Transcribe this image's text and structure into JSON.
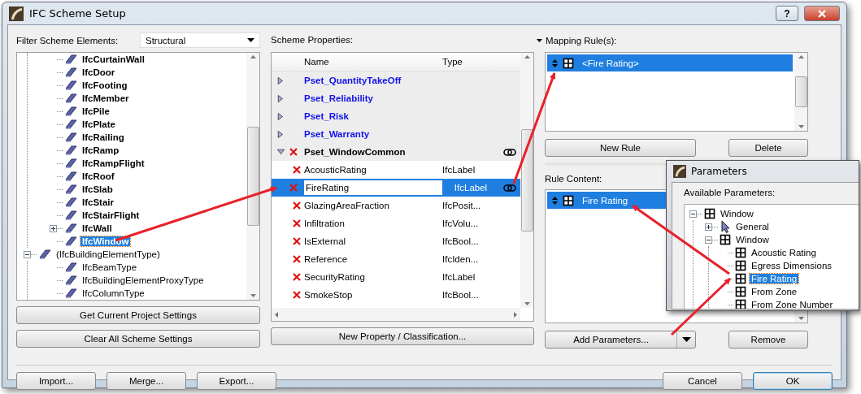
{
  "window": {
    "title": "IFC Scheme Setup",
    "help_button": "?"
  },
  "filter": {
    "label": "Filter Scheme Elements:",
    "value": "Structural"
  },
  "element_tree": [
    {
      "children": [
        {
          "label": "IfcCurtainWall",
          "selected": false
        },
        {
          "label": "IfcDoor",
          "selected": false
        },
        {
          "label": "IfcFooting",
          "selected": false
        },
        {
          "label": "IfcMember",
          "selected": false
        },
        {
          "label": "IfcPile",
          "selected": false
        },
        {
          "label": "IfcPlate",
          "selected": false
        },
        {
          "label": "IfcRailing",
          "selected": false
        },
        {
          "label": "IfcRamp",
          "selected": false
        },
        {
          "label": "IfcRampFlight",
          "selected": false
        },
        {
          "label": "IfcRoof",
          "selected": false
        },
        {
          "label": "IfcSlab",
          "selected": false
        },
        {
          "label": "IfcStair",
          "selected": false
        },
        {
          "label": "IfcStairFlight",
          "selected": false
        },
        {
          "label": "IfcWall",
          "selected": false,
          "expanded": false
        },
        {
          "label": "IfcWindow",
          "selected": true
        }
      ]
    },
    {
      "label": "(IfcBuildingElementType)",
      "selected": false,
      "expanded": true,
      "children": [
        {
          "label": "IfcBeamType",
          "selected": false
        },
        {
          "label": "IfcBuildingElementProxyType",
          "selected": false
        },
        {
          "label": "IfcColumnType",
          "selected": false
        }
      ]
    }
  ],
  "left_buttons": [
    "Get Current Project Settings",
    "Clear All Scheme Settings"
  ],
  "scheme_properties": {
    "label": "Scheme Properties:",
    "columns": [
      "Name",
      "Type"
    ],
    "rows": [
      {
        "kind": "pset",
        "name": "Pset_QuantityTakeOff",
        "expanded": false,
        "deletable": false,
        "linked": false,
        "selected": false
      },
      {
        "kind": "pset",
        "name": "Pset_Reliability",
        "expanded": false,
        "deletable": false,
        "linked": false,
        "selected": false
      },
      {
        "kind": "pset",
        "name": "Pset_Risk",
        "expanded": false,
        "deletable": false,
        "linked": false,
        "selected": false
      },
      {
        "kind": "pset",
        "name": "Pset_Warranty",
        "expanded": false,
        "deletable": false,
        "linked": false,
        "selected": false
      },
      {
        "kind": "pset",
        "name": "Pset_WindowCommon",
        "expanded": true,
        "deletable": true,
        "linked": true,
        "selected": false
      },
      {
        "kind": "property",
        "name": "AcousticRating",
        "type": "IfcLabel",
        "deletable": true,
        "linked": false,
        "selected": false
      },
      {
        "kind": "property",
        "name": "FireRating",
        "type": "IfcLabel",
        "deletable": true,
        "linked": true,
        "selected": true
      },
      {
        "kind": "property",
        "name": "GlazingAreaFraction",
        "type": "IfcPosit...",
        "deletable": true,
        "linked": false,
        "selected": false
      },
      {
        "kind": "property",
        "name": "Infiltration",
        "type": "IfcVolu...",
        "deletable": true,
        "linked": false,
        "selected": false
      },
      {
        "kind": "property",
        "name": "IsExternal",
        "type": "IfcBool...",
        "deletable": true,
        "linked": false,
        "selected": false
      },
      {
        "kind": "property",
        "name": "Reference",
        "type": "IfcIden...",
        "deletable": true,
        "linked": false,
        "selected": false
      },
      {
        "kind": "property",
        "name": "SecurityRating",
        "type": "IfcLabel",
        "deletable": true,
        "linked": false,
        "selected": false
      },
      {
        "kind": "property",
        "name": "SmokeStop",
        "type": "IfcBool...",
        "deletable": true,
        "linked": false,
        "selected": false
      }
    ],
    "button": "New Property / Classification..."
  },
  "mapping_rules": {
    "label": "Mapping Rule(s):",
    "rules": [
      {
        "text": "<Fire Rating>",
        "selected": true
      }
    ],
    "buttons": [
      "New Rule",
      "Delete"
    ]
  },
  "rule_content": {
    "label": "Rule Content:",
    "items": [
      {
        "text": "Fire Rating",
        "selected": true
      }
    ],
    "add_button": "Add Parameters...",
    "remove_button": "Remove"
  },
  "footer": {
    "left_buttons": [
      "Import...",
      "Merge...",
      "Export..."
    ],
    "right_buttons": [
      {
        "label": "Cancel",
        "default": false
      },
      {
        "label": "OK",
        "default": true
      }
    ]
  },
  "parameters_dialog": {
    "title": "Parameters",
    "label": "Available Parameters:",
    "tree": [
      {
        "label": "Window",
        "kind": "window",
        "expanded": true,
        "selected": false,
        "children": [
          {
            "label": "General",
            "kind": "general",
            "expanded": false,
            "selected": false
          },
          {
            "label": "Window",
            "kind": "window",
            "expanded": true,
            "selected": false,
            "children": [
              {
                "label": "Acoustic Rating",
                "kind": "window",
                "selected": false
              },
              {
                "label": "Egress Dimensions",
                "kind": "window",
                "selected": false
              },
              {
                "label": "Fire Rating",
                "kind": "window",
                "selected": true
              },
              {
                "label": "From Zone",
                "kind": "window",
                "selected": false
              },
              {
                "label": "From Zone Number",
                "kind": "window",
                "selected": false
              }
            ]
          }
        ]
      }
    ]
  }
}
